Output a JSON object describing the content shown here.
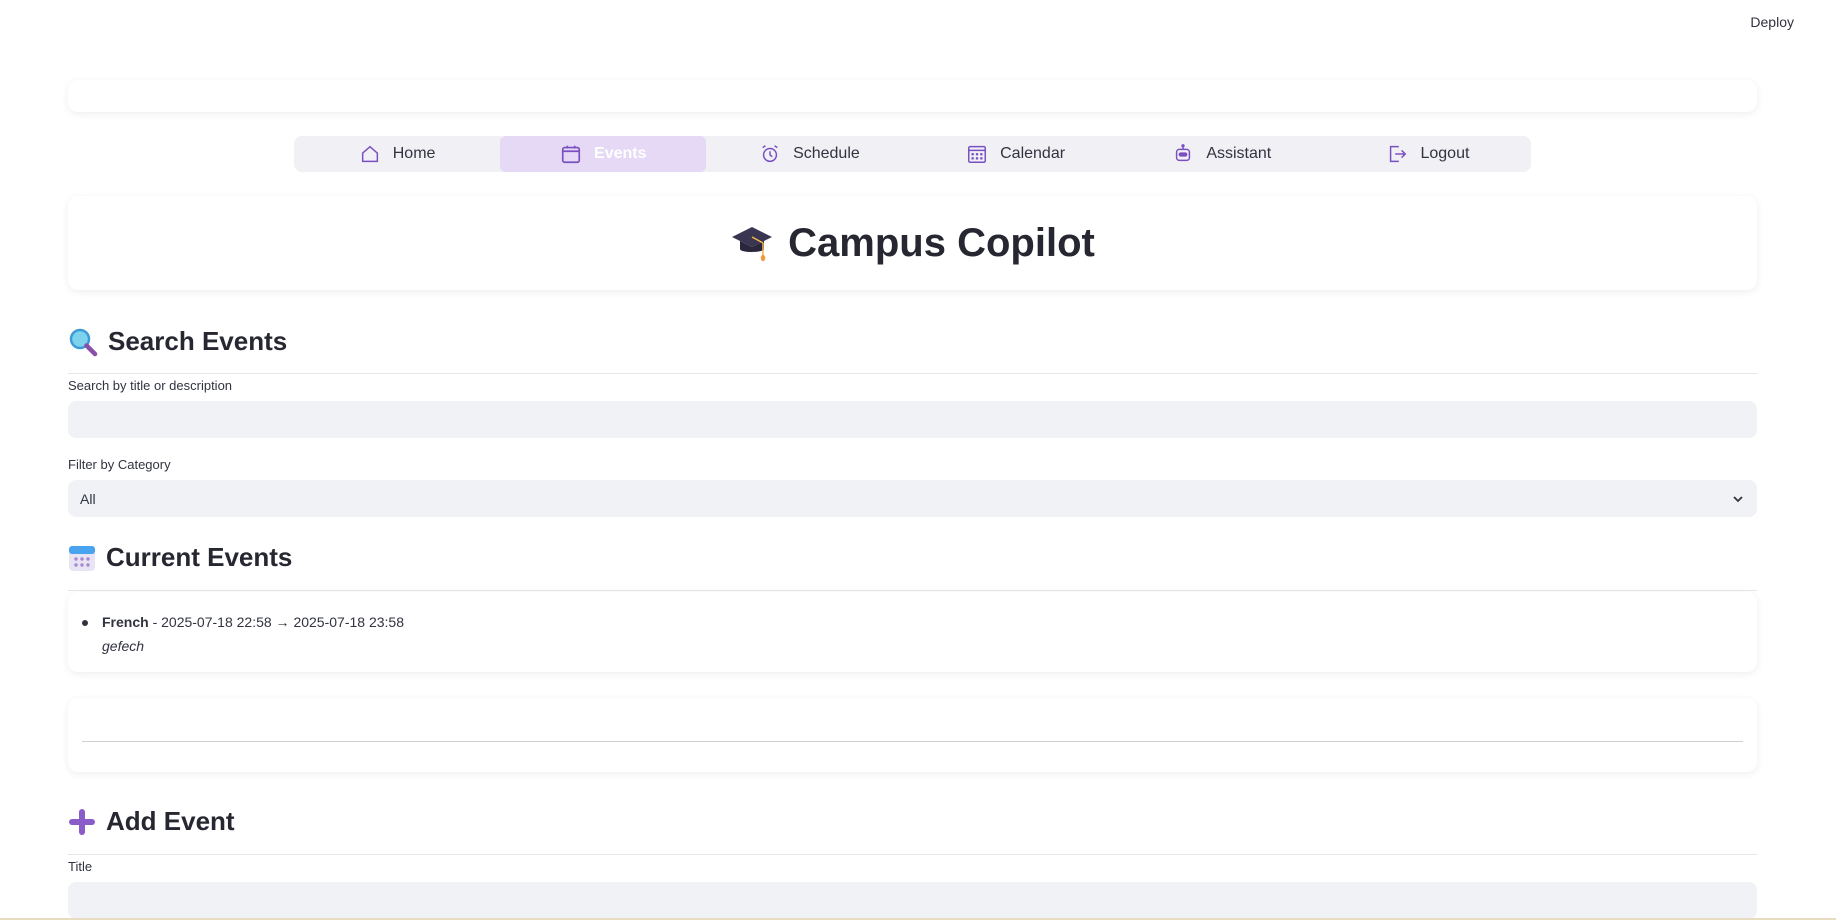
{
  "header": {
    "deploy_label": "Deploy"
  },
  "nav": {
    "items": [
      {
        "label": "Home",
        "icon": "home-icon"
      },
      {
        "label": "Events",
        "icon": "calendar-icon",
        "active": true
      },
      {
        "label": "Schedule",
        "icon": "alarm-clock-icon"
      },
      {
        "label": "Calendar",
        "icon": "calendar-grid-icon"
      },
      {
        "label": "Assistant",
        "icon": "robot-icon"
      },
      {
        "label": "Logout",
        "icon": "logout-icon"
      }
    ],
    "accent": "#7a4fc2",
    "active_bg": "#e5d9f5"
  },
  "app": {
    "title": "Campus Copilot",
    "title_icon": "graduation-cap-icon"
  },
  "search": {
    "heading": "Search Events",
    "heading_icon": "magnifier-icon",
    "search_label": "Search by title or description",
    "search_value": "",
    "filter_label": "Filter by Category",
    "filter_value": "All"
  },
  "current": {
    "heading": "Current Events",
    "heading_icon": "calendar-emoji-icon",
    "events": [
      {
        "title": "French",
        "time": " - 2025-07-18 22:58 → 2025-07-18 23:58",
        "description": "gefech"
      }
    ]
  },
  "add": {
    "heading": "Add Event",
    "heading_icon": "plus-icon",
    "title_label": "Title",
    "title_value": ""
  }
}
